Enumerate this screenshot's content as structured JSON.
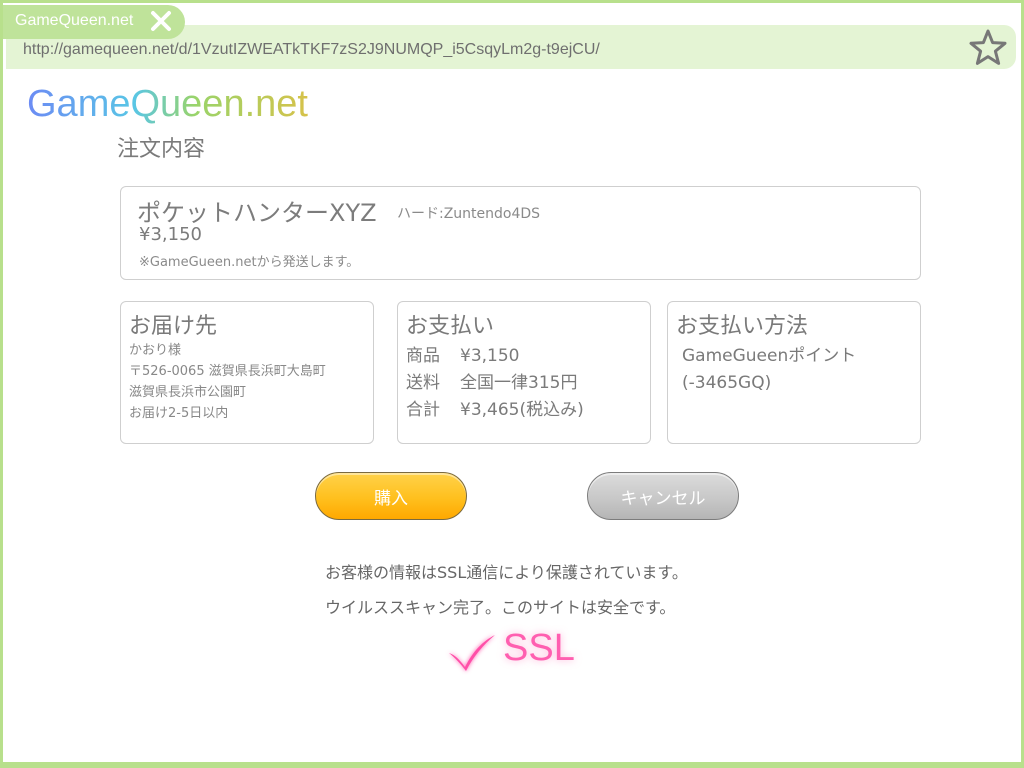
{
  "browser": {
    "tab_title": "GameQueen.net",
    "url": "http://gamequeen.net/d/1VzutIZWEATkTKF7zS2J9NUMQP_i5CsqyLm2g-t9ejCU/"
  },
  "page": {
    "logo": "GameQueen.net",
    "title": "注文内容"
  },
  "product": {
    "name": "ポケットハンターXYZ",
    "hardware": "ハード:Zuntendo4DS",
    "price": "¥3,150",
    "note": "※GameGueen.netから発送します。"
  },
  "delivery": {
    "heading": "お届け先",
    "lines": [
      "かおり様",
      "〒526-0065 滋賀県長浜町大島町",
      "滋賀県長浜市公園町",
      "お届け2-5日以内"
    ]
  },
  "payment": {
    "heading": "お支払い",
    "rows": [
      {
        "label": "商品",
        "value": "¥3,150"
      },
      {
        "label": "送料",
        "value": "全国一律315円"
      },
      {
        "label": "合計",
        "value": "¥3,465(税込み)"
      }
    ]
  },
  "payment_method": {
    "heading": "お支払い方法",
    "lines": [
      "GameGueenポイント",
      "(-3465GQ)"
    ]
  },
  "buttons": {
    "buy": "購入",
    "cancel": "キャンセル"
  },
  "security": {
    "line1": "お客様の情報はSSL通信により保護されています。",
    "line2": "ウイルススキャン完了。このサイトは安全です。",
    "badge": "SSL"
  },
  "colors": {
    "accent_green": "#b8e08c",
    "buy_orange": "#ffc01e",
    "ssl_pink": "#ff5fb0"
  }
}
